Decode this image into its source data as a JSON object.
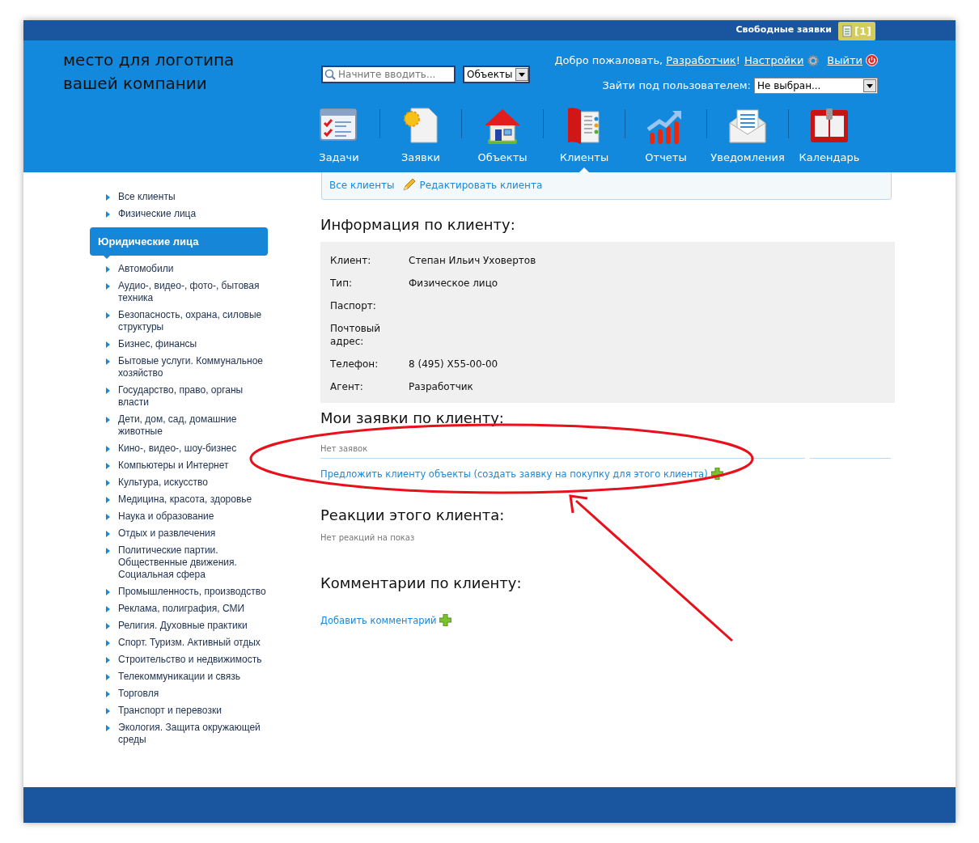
{
  "top_bar": {
    "label": "Свободные заявки",
    "count": "[1]"
  },
  "logo": {
    "lines": [
      "место для логотипа",
      "вашей компании"
    ]
  },
  "search": {
    "placeholder": "Начните вводить...",
    "scope": "Объекты"
  },
  "user_bar": {
    "greeting": "Добро пожаловать,",
    "user": "Разработчик",
    "after_user": "!",
    "settings": "Настройки",
    "logout": "Выйти"
  },
  "impersonate": {
    "label": "Зайти под пользователем:",
    "value": "Не выбран..."
  },
  "nav": [
    {
      "label": "Задачи",
      "kind": "tasks",
      "selected": false
    },
    {
      "label": "Заявки",
      "kind": "requests",
      "selected": false
    },
    {
      "label": "Объекты",
      "kind": "house",
      "selected": false
    },
    {
      "label": "Клиенты",
      "kind": "book",
      "selected": true
    },
    {
      "label": "Отчеты",
      "kind": "chart",
      "selected": false
    },
    {
      "label": "Уведомления",
      "kind": "envelope",
      "selected": false
    },
    {
      "label": "Календарь",
      "kind": "calendar",
      "selected": false
    }
  ],
  "subnav": [
    {
      "label": "Все клиенты",
      "kind": "link"
    },
    {
      "label": "Редактировать клиента",
      "kind": "edit"
    }
  ],
  "sidebar": {
    "items": [
      {
        "label": "Все клиенты",
        "selected": false
      },
      {
        "label": "Физические лица",
        "selected": false
      },
      {
        "label": "Юридические лица",
        "selected": true,
        "children": [
          {
            "label": "Автомобили"
          },
          {
            "label": "Аудио-, видео-, фото-, бытовая техника"
          },
          {
            "label": "Безопасность, охрана, силовые структуры"
          },
          {
            "label": "Бизнес, финансы"
          },
          {
            "label": "Бытовые услуги. Коммунальное хозяйство"
          },
          {
            "label": "Государство, право, органы власти"
          },
          {
            "label": "Дети, дом, сад, домашние животные"
          },
          {
            "label": "Кино-, видео-, шоу-бизнес"
          },
          {
            "label": "Компьютеры и Интернет"
          },
          {
            "label": "Культура, искусство"
          },
          {
            "label": "Медицина, красота, здоровье"
          },
          {
            "label": "Наука и образование"
          },
          {
            "label": "Отдых и развлечения"
          },
          {
            "label": "Политические партии. Общественные движения. Социальная сфера"
          },
          {
            "label": "Промышленность, производство"
          },
          {
            "label": "Реклама, полиграфия, СМИ"
          },
          {
            "label": "Религия. Духовные практики"
          },
          {
            "label": "Спорт. Туризм. Активный отдых"
          },
          {
            "label": "Строительство и недвижимость"
          },
          {
            "label": "Телекоммуникации и связь"
          },
          {
            "label": "Торговля"
          },
          {
            "label": "Транспорт и перевозки"
          },
          {
            "label": "Экология. Защита окружающей среды"
          }
        ]
      }
    ]
  },
  "client_info": {
    "title": "Информация по клиенту:",
    "rows": [
      {
        "label": "Клиент:",
        "value": "Степан Ильич Уховертов"
      },
      {
        "label": "Тип:",
        "value": "Физическое лицо"
      },
      {
        "label": "Паспорт:"
      },
      {
        "label": "Почтовый адрес:"
      },
      {
        "label": "Телефон:",
        "value": "8 (495) X55-00-00"
      },
      {
        "label": "Агент:",
        "value": "Разработчик"
      }
    ]
  },
  "requests": {
    "title": "Мои заявки по клиенту:",
    "empty": "Нет заявок",
    "action": "Предложить клиенту объекты (создать заявку на покупку для этого клиента)"
  },
  "reactions": {
    "title": "Реакции этого клиента:",
    "empty": "Нет реакций на показ"
  },
  "comments": {
    "title": "Комментарии по клиенту:",
    "action": "Добавить комментарий"
  }
}
